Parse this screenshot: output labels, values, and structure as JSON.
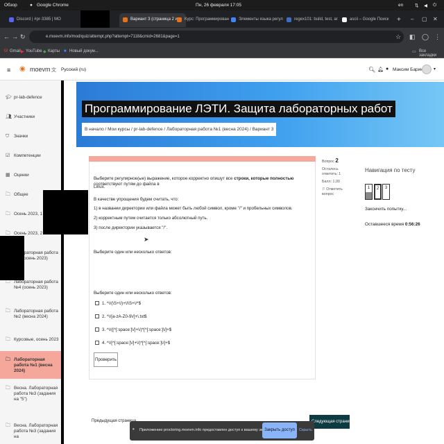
{
  "os": {
    "overview": "Обзор",
    "app": "Google Chrome",
    "clock": "Пн, 26 февраля 17:05",
    "lang": "en"
  },
  "tabs": [
    {
      "label": "Discord | #pr-3385 | MO"
    },
    {
      "label": ""
    },
    {
      "label": "Вариант 3 (страница 2 из"
    },
    {
      "label": "Курс: Программирован"
    },
    {
      "label": "Элементы языка регул"
    },
    {
      "label": "regex101: build, test, ar"
    },
    {
      "label": "ascii – Google Поиск"
    }
  ],
  "address": {
    "url": "e.moevm.info/mod/quiz/attempt.php?attempt=7118&cmid=2681&page=1"
  },
  "bookmarks": {
    "items": [
      "Gmail",
      "YouTube",
      "Карты",
      "Новый докум..."
    ],
    "all": "Все закладки"
  },
  "header": {
    "logo": "moevm",
    "language": "Русский (ru)",
    "user": "Максим Баринов"
  },
  "drawer": {
    "items": [
      {
        "label": "pr-lab-defence",
        "icon": "graduation-cap-icon"
      },
      {
        "label": "Участники",
        "icon": "users-icon"
      },
      {
        "label": "Значки",
        "icon": "shield-icon"
      },
      {
        "label": "Компетенции",
        "icon": "checkbox-icon"
      },
      {
        "label": "Оценки",
        "icon": "grades-icon"
      },
      {
        "label": "Общее",
        "icon": "folder-icon"
      },
      {
        "label": "Осень 2023, 1 ЛР",
        "icon": "folder-icon"
      },
      {
        "label": "Осень 2023, 2 ЛР",
        "icon": "folder-icon"
      },
      {
        "label": "Лабораторная работа №3 (осень 2023)",
        "icon": "folder-icon"
      },
      {
        "label": "Лабораторная работа №4 (осень 2023)",
        "icon": "folder-icon"
      },
      {
        "label": "Лабораторная работа №2 (весна 2024)",
        "icon": "folder-icon"
      },
      {
        "label": "Курсовые, осень 2023",
        "icon": "folder-icon"
      },
      {
        "label": "Лабораторная работа №1 (весна 2024)",
        "icon": "folder-icon"
      },
      {
        "label": "Весна. Лабораторная работа №3 (задания на \"5\")",
        "icon": "folder-icon"
      },
      {
        "label": "Весна. Лабораторная работа №3 (задания на",
        "icon": "folder-icon"
      }
    ]
  },
  "page": {
    "title": "Программирование ЛЭТИ. Защита лабораторных работ",
    "breadcrumb": "В начало  /  Мои курсы  /  pr-lab-defence  /  Лабораторная работа №1 (весна 2024)  /  Вариант 3"
  },
  "question": {
    "info_label": "Вопрос",
    "info_number": "2",
    "info_status": "Осталось ответить: 1",
    "info_mark": "Балл: 1,00",
    "info_flag": "Отметить вопрос",
    "text_1_a": "Выберите регулярное(ые) выражение, которое корректно опишут все ",
    "text_1_b": "строки, которые полностью",
    "text_1_c": " соответствуют путям до файла в",
    "text_2": "Linux.",
    "text_3": "В качестве упрощения будем считать, что:",
    "text_4": "1) в названии директории или файла может быть любой символ, кроме \"/\" и пробельных символов.",
    "text_5": "2) корректным путем считается только абсолютный путь.",
    "text_6": "3) после директории указывается \"/\".",
    "prompt_1": "Выберите один или несколько ответов:",
    "prompt_2": "Выберите один или несколько ответов:",
    "options": [
      "1. ^\\/(\\S+\\/)+\\/\\S+\\/*$",
      "2. ^\\/[a-zA-Z0-9\\/]+\\.txt$",
      "3. ^\\/([^[:space:]\\/]+\\/)*[^[:space:]\\/]+$",
      "4. ^\\/[^[:space:]\\/]+\\/)*[^[:space:]\\/]+$"
    ],
    "check_button": "Проверить"
  },
  "quiz_nav": {
    "title": "Навигация по тесту",
    "finish": "Закончить попытку...",
    "time_label": "Оставшееся время",
    "time_value": "0:56:26",
    "pages": [
      "1",
      "2",
      "3"
    ]
  },
  "footer": {
    "prev": "Предыдущая страница",
    "next": "Следующая страница"
  },
  "notification": {
    "text": "Приложению proctoring.moevm.info предоставлен доступ к вашему экрану.",
    "allow": "Закрыть доступ",
    "hide": "Скрыть"
  }
}
